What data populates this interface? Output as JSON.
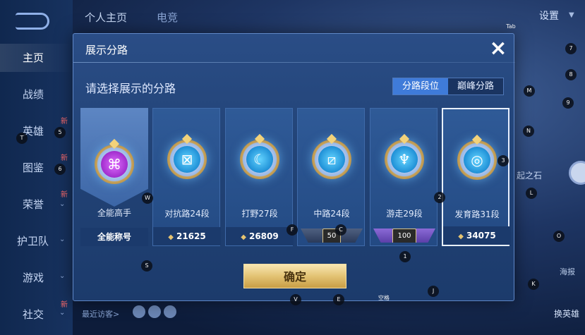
{
  "left_nav": {
    "items": [
      {
        "label": "主页",
        "new": "",
        "chevron": false
      },
      {
        "label": "战绩",
        "new": "",
        "chevron": false
      },
      {
        "label": "英雄",
        "new": "新",
        "chevron": false
      },
      {
        "label": "图鉴",
        "new": "新",
        "chevron": false
      },
      {
        "label": "荣誉",
        "new": "新",
        "chevron": true
      },
      {
        "label": "护卫队",
        "new": "",
        "chevron": true
      },
      {
        "label": "游戏",
        "new": "",
        "chevron": true
      },
      {
        "label": "社交",
        "new": "新",
        "chevron": true
      }
    ]
  },
  "top": {
    "tab_1": "个人主页",
    "tab_2": "电竞",
    "settings": "设置"
  },
  "side": {
    "hero_name": "起之石",
    "report": "海报",
    "swap_hero": "换英雄",
    "recent_visitors": "最近访客>"
  },
  "modal": {
    "title": "展示分路",
    "close_icon": "×",
    "subtitle": "请选择展示的分路",
    "segments": [
      "分路段位",
      "巅峰分路"
    ],
    "active_segment": 0,
    "confirm": "确定",
    "cards": [
      {
        "label": "全能高手",
        "foot": "全能称号",
        "icon": "⌘",
        "selected": false
      },
      {
        "label": "对抗路24段",
        "foot": "21625",
        "icon": "⊠",
        "selected": false
      },
      {
        "label": "打野27段",
        "foot": "26809",
        "icon": "☾",
        "selected": false
      },
      {
        "label": "中路24段",
        "foot": "50",
        "icon": "⧄",
        "selected": false
      },
      {
        "label": "游走29段",
        "foot": "100",
        "icon": "♆",
        "selected": false
      },
      {
        "label": "发育路31段",
        "foot": "34075",
        "icon": "◎",
        "selected": true
      }
    ]
  },
  "key_hints": [
    "Tab",
    "7",
    "8",
    "M",
    "9",
    "N",
    "3",
    "L",
    "O",
    "K",
    "T",
    "5",
    "6",
    "W",
    "2",
    "F",
    "C",
    "1",
    "S",
    "V",
    "E",
    "空格",
    "J"
  ],
  "colors": {
    "accent": "#3f7bd9",
    "gold": "#e3c374",
    "panel": "#234a83"
  }
}
